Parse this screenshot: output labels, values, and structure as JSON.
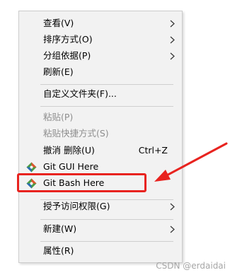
{
  "menu": {
    "items": [
      {
        "label": "查看(V)",
        "submenu": true
      },
      {
        "label": "排序方式(O)",
        "submenu": true
      },
      {
        "label": "分组依据(P)",
        "submenu": true
      },
      {
        "label": "刷新(E)"
      },
      {
        "label": "自定义文件夹(F)..."
      },
      {
        "label": "粘贴(P)",
        "disabled": true
      },
      {
        "label": "粘贴快捷方式(S)",
        "disabled": true
      },
      {
        "label": "撤消 删除(U)",
        "shortcut": "Ctrl+Z"
      },
      {
        "label": "Git GUI Here",
        "icon": "git-icon"
      },
      {
        "label": "Git Bash Here",
        "icon": "git-icon"
      },
      {
        "label": "授予访问权限(G)",
        "submenu": true
      },
      {
        "label": "新建(W)",
        "submenu": true
      },
      {
        "label": "属性(R)"
      }
    ]
  },
  "annotation": {
    "highlight_color": "#e8231f"
  },
  "watermark": "CSDN @erdaidai"
}
